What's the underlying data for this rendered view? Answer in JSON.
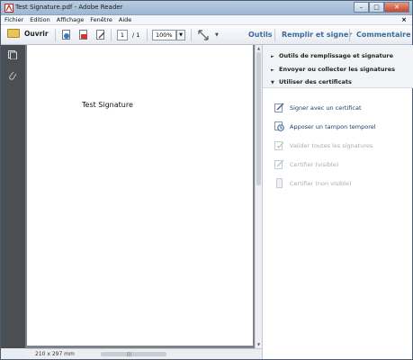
{
  "window": {
    "title": "Test Signature.pdf - Adobe Reader"
  },
  "menu": {
    "items": [
      "Fichier",
      "Edition",
      "Affichage",
      "Fenêtre",
      "Aide"
    ],
    "close_glyph": "×"
  },
  "toolbar": {
    "open_label": "Ouvrir",
    "current_page": "1",
    "total_pages": "/ 1",
    "zoom": "100%",
    "tabs": [
      "Outils",
      "Remplir et signer",
      "Commentaire"
    ]
  },
  "document": {
    "text": "Test Signature",
    "page_size": "210 x 297 mm"
  },
  "panel": {
    "sections": [
      {
        "label": "Outils de remplissage et signature",
        "expanded": false
      },
      {
        "label": "Envoyer ou collecter les signatures",
        "expanded": false
      },
      {
        "label": "Utiliser des certificats",
        "expanded": true
      }
    ],
    "actions": [
      {
        "label": "Signer avec un certificat",
        "enabled": true,
        "icon": "pen-sign-icon"
      },
      {
        "label": "Apposer un tampon temporel",
        "enabled": true,
        "icon": "clock-stamp-icon"
      },
      {
        "label": "Valider toutes les signatures",
        "enabled": false,
        "icon": "validate-signatures-icon"
      },
      {
        "label": "Certifier (visible)",
        "enabled": false,
        "icon": "certify-visible-icon"
      },
      {
        "label": "Certifier (non visible)",
        "enabled": false,
        "icon": "certify-invisible-icon"
      }
    ]
  },
  "colors": {
    "accent_tab": "#3c6a99",
    "action_enabled": "#1f3d6b",
    "action_disabled": "#a5aeb8"
  }
}
